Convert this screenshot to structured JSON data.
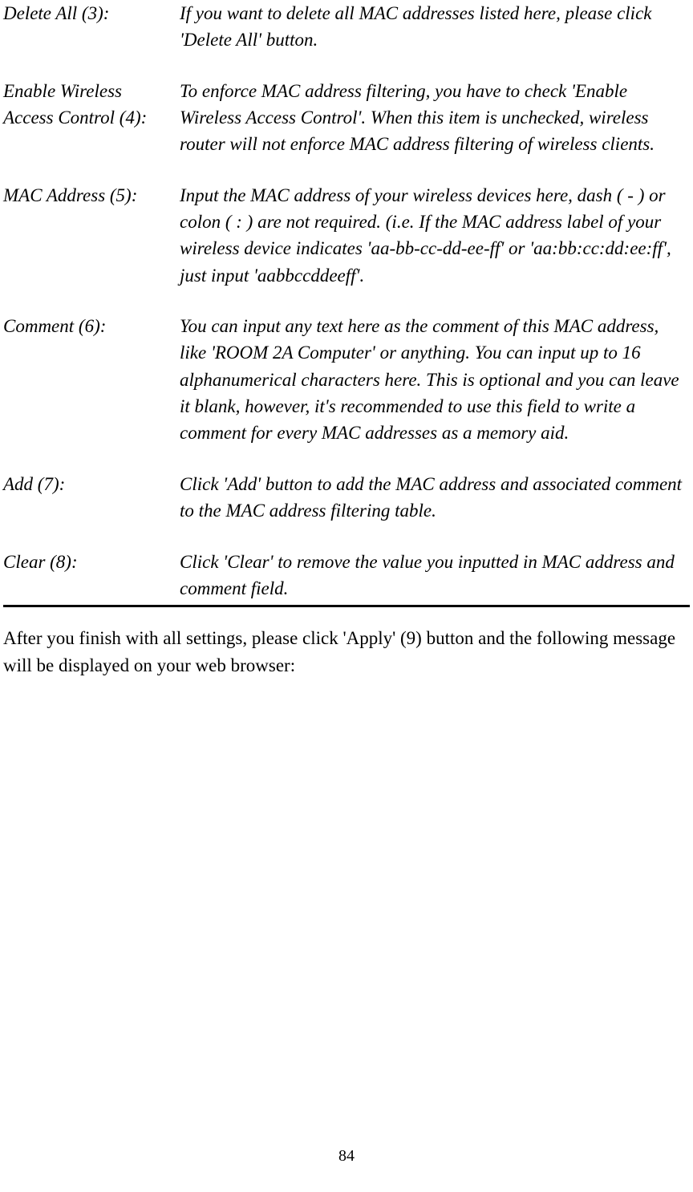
{
  "entries": [
    {
      "term": "Delete All (3):",
      "desc": "If you want to delete all MAC addresses listed here, please click 'Delete All' button."
    },
    {
      "term": "Enable Wireless Access Control (4):",
      "desc": "To enforce MAC address filtering, you have to check 'Enable Wireless Access Control'. When this item is unchecked, wireless router will not enforce MAC address filtering of wireless clients."
    },
    {
      "term": "MAC Address (5):",
      "desc": "Input the MAC address of your wireless devices here, dash ( - ) or colon ( : ) are not required. (i.e. If the MAC address label of your wireless device indicates 'aa-bb-cc-dd-ee-ff' or 'aa:bb:cc:dd:ee:ff', just input 'aabbccddeeff'."
    },
    {
      "term": "Comment (6):",
      "desc": "You can input any text here as the comment of this MAC address, like 'ROOM 2A Computer' or anything. You can input up to 16 alphanumerical characters here. This is optional and you can leave it blank, however, it's recommended to use this field to write a comment for every MAC addresses as a memory aid."
    },
    {
      "term": "Add (7):",
      "desc": "Click 'Add' button to add the MAC address and associated comment to the MAC address filtering table."
    },
    {
      "term": "Clear (8):",
      "desc": "Click 'Clear' to remove the value you inputted in MAC address and comment field."
    }
  ],
  "closing": "After you finish with all settings, please click 'Apply' (9) button and the following message will be displayed on your web browser:",
  "pageNumber": "84"
}
